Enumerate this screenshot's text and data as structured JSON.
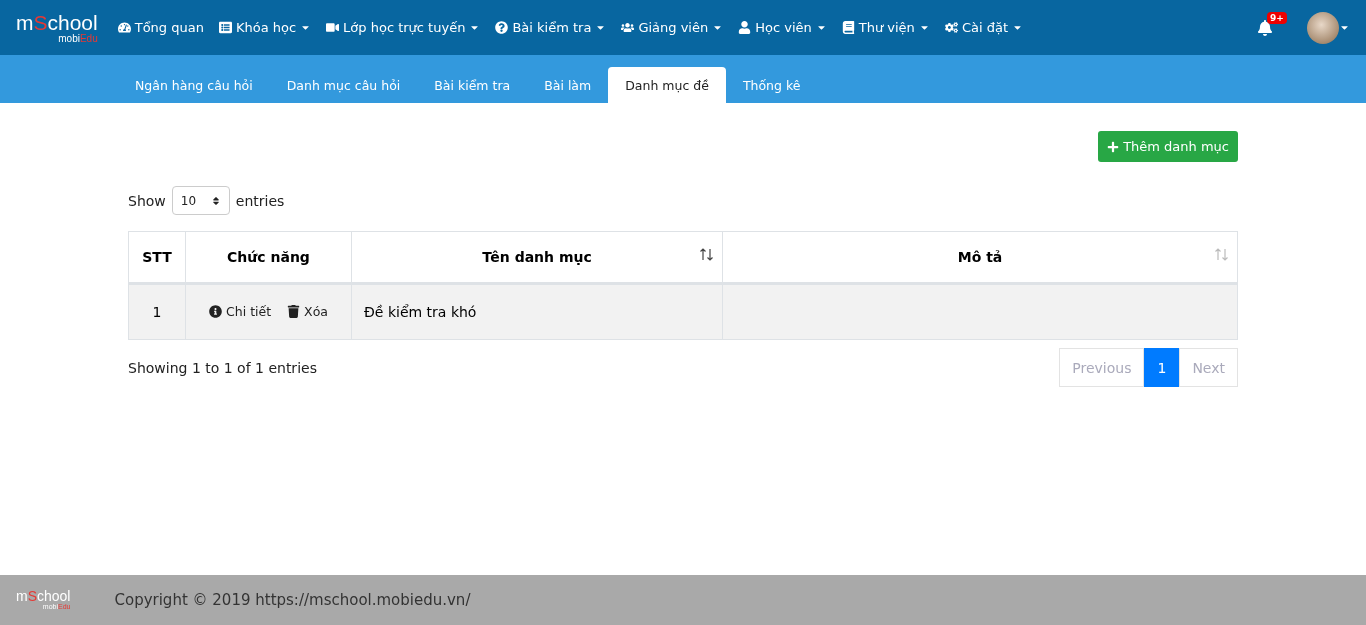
{
  "logo": {
    "lead": "m",
    "accent": "S",
    "rest": "chool",
    "sub_lead": "mobi",
    "sub_accent": "Edu"
  },
  "nav": [
    {
      "label": "Tổng quan",
      "dropdown": false
    },
    {
      "label": "Khóa học",
      "dropdown": true
    },
    {
      "label": "Lớp học trực tuyến",
      "dropdown": true
    },
    {
      "label": "Bài kiểm tra",
      "dropdown": true
    },
    {
      "label": "Giảng viên",
      "dropdown": true
    },
    {
      "label": "Học viên",
      "dropdown": true
    },
    {
      "label": "Thư viện",
      "dropdown": true
    },
    {
      "label": "Cài đặt",
      "dropdown": true
    }
  ],
  "notifications": {
    "badge": "9+"
  },
  "tabs": [
    {
      "label": "Ngân hàng câu hỏi",
      "selected": false
    },
    {
      "label": "Danh mục câu hỏi",
      "selected": false
    },
    {
      "label": "Bài kiểm tra",
      "selected": false
    },
    {
      "label": "Bài làm",
      "selected": false
    },
    {
      "label": "Danh mục đề",
      "selected": true
    },
    {
      "label": "Thống kê",
      "selected": false
    }
  ],
  "add_button": "Thêm danh mục",
  "length": {
    "before": "Show",
    "value": "10",
    "after": "entries"
  },
  "table": {
    "columns": [
      {
        "label": "STT",
        "sortable": false
      },
      {
        "label": "Chức năng",
        "sortable": false
      },
      {
        "label": "Tên danh mục",
        "sortable": true
      },
      {
        "label": "Mô tả",
        "sortable": true
      }
    ],
    "rows": [
      {
        "stt": "1",
        "actions": [
          "Chi tiết",
          "Xóa"
        ],
        "name": "Đề kiểm tra khó"
      }
    ]
  },
  "info": "Showing 1 to 1 of 1 entries",
  "pagination": [
    {
      "label": "Previous",
      "selected": false
    },
    {
      "label": "1",
      "selected": true
    },
    {
      "label": "Next",
      "selected": false
    }
  ],
  "footer_logo": {
    "lead": "m",
    "accent": "S",
    "rest": "chool",
    "sub_lead": "mobi",
    "sub_accent": "Edu"
  },
  "footer": "Copyright © 2019 https://mschool.mobiedu.vn/"
}
